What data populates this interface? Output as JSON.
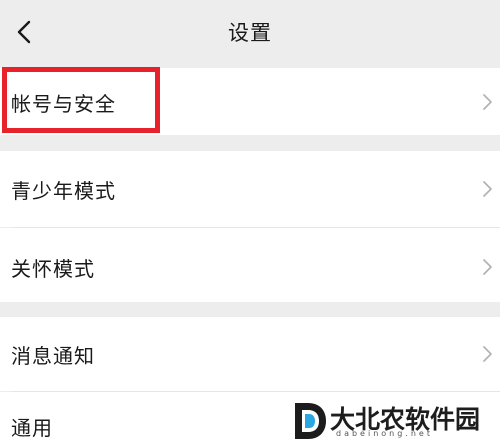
{
  "header": {
    "title": "设置",
    "back_icon": "chevron-left-icon"
  },
  "settings": {
    "items": [
      {
        "label": "帐号与安全",
        "highlighted": true
      },
      {
        "label": "青少年模式"
      },
      {
        "label": "关怀模式"
      },
      {
        "label": "消息通知"
      },
      {
        "label": "通用"
      }
    ],
    "chevron_icon": "chevron-right-icon"
  },
  "watermark": {
    "name": "大北农软件园",
    "url": "dabeinong.net"
  },
  "colors": {
    "background": "#ededed",
    "row": "#ffffff",
    "highlight_border": "#e8222b",
    "chevron": "#b3b3b3"
  }
}
